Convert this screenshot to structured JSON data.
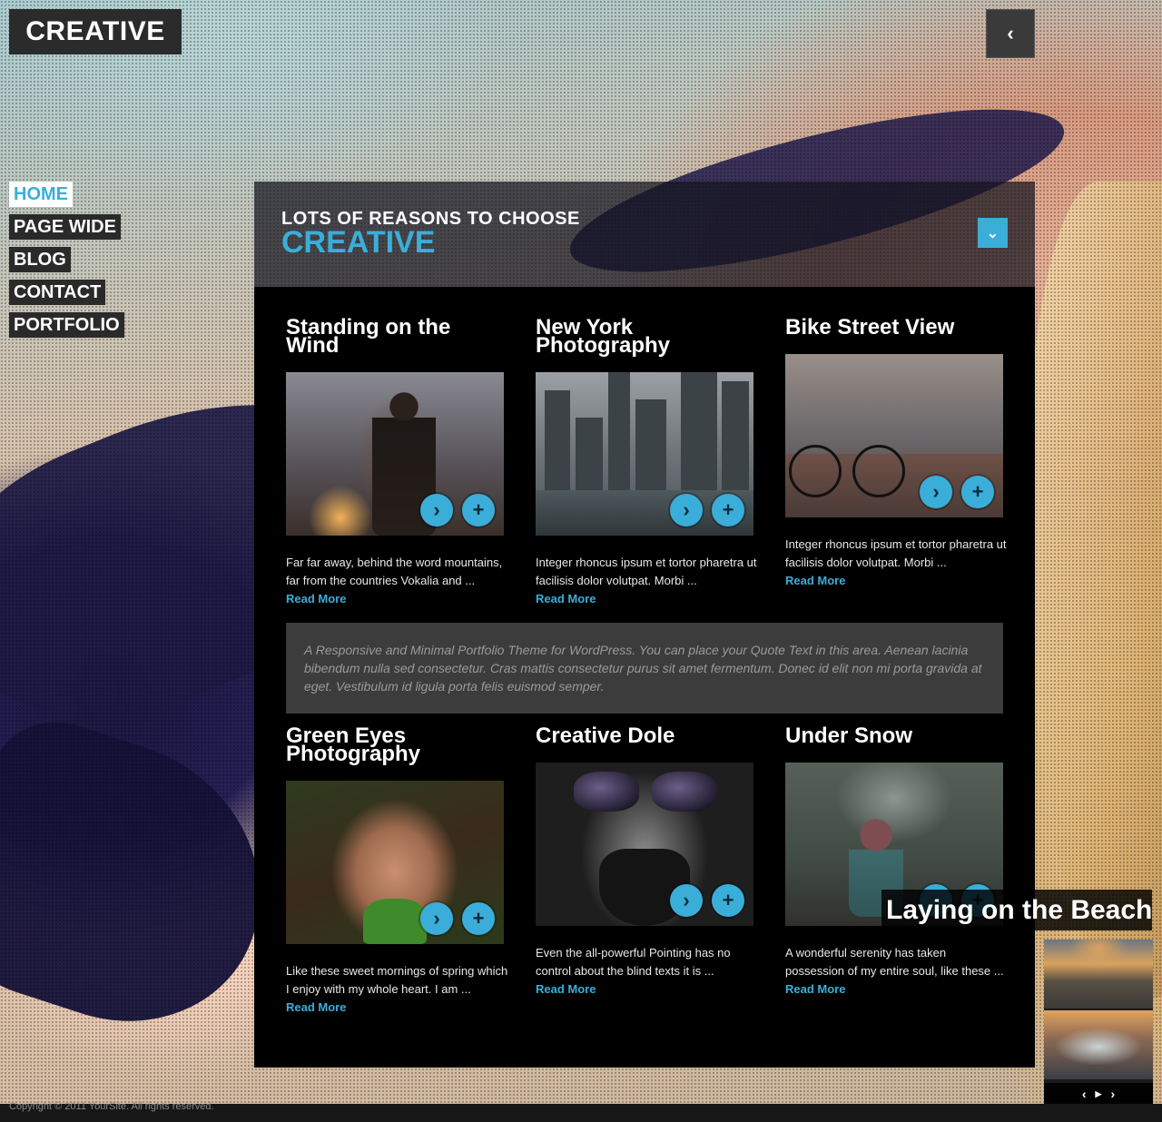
{
  "logo": {
    "text": "CREATIVE"
  },
  "header": {
    "collapse_icon": "‹"
  },
  "nav": {
    "items": [
      {
        "label": "HOME",
        "active": true
      },
      {
        "label": "PAGE WIDE"
      },
      {
        "label": "BLOG"
      },
      {
        "label": "CONTACT"
      },
      {
        "label": "PORTFOLIO"
      }
    ]
  },
  "intro": {
    "subtitle": "LOTS OF REASONS TO CHOOSE",
    "title": "CREATIVE",
    "toggle_icon": "⌄"
  },
  "cards": [
    {
      "title": "Standing on the Wind",
      "text": "Far far away, behind the word mountains, far from the countries Vokalia and ...",
      "more": "Read More"
    },
    {
      "title": "New York Photography",
      "text": "Integer rhoncus ipsum et tortor pharetra ut facilisis dolor volutpat. Morbi ...",
      "more": "Read More"
    },
    {
      "title": "Bike Street View",
      "text": "Integer rhoncus ipsum et tortor pharetra ut facilisis dolor volutpat. Morbi ...",
      "more": "Read More"
    },
    {
      "title": "Green Eyes Photography",
      "text": "Like these sweet mornings of spring which I enjoy with my whole heart. I am ...",
      "more": "Read More"
    },
    {
      "title": "Creative Dole",
      "text": "Even the all-powerful Pointing has no control about the blind texts it is ...",
      "more": "Read More"
    },
    {
      "title": "Under Snow",
      "text": "A wonderful serenity has taken possession of my entire soul, like these ...",
      "more": "Read More"
    }
  ],
  "card_icons": {
    "open": "›",
    "zoom": "+"
  },
  "quote": "A Responsive and Minimal Portfolio Theme for WordPress. You can place your Quote Text in this area. Aenean lacinia bibendum nulla sed consectetur. Cras mattis consectetur purus sit amet fermentum. Donec id elit non mi porta gravida at eget. Vestibulum id ligula porta felis euismod semper.",
  "slider": {
    "caption": "Laying on the Beach",
    "prev": "‹",
    "play": "▶",
    "next": "›"
  },
  "footer": {
    "copyright": "Copyright © 2011 YourSite. All rights reserved."
  },
  "colors": {
    "accent": "#3aaed9",
    "panel": "#000000",
    "quote_bg": "#3c3c3c"
  }
}
